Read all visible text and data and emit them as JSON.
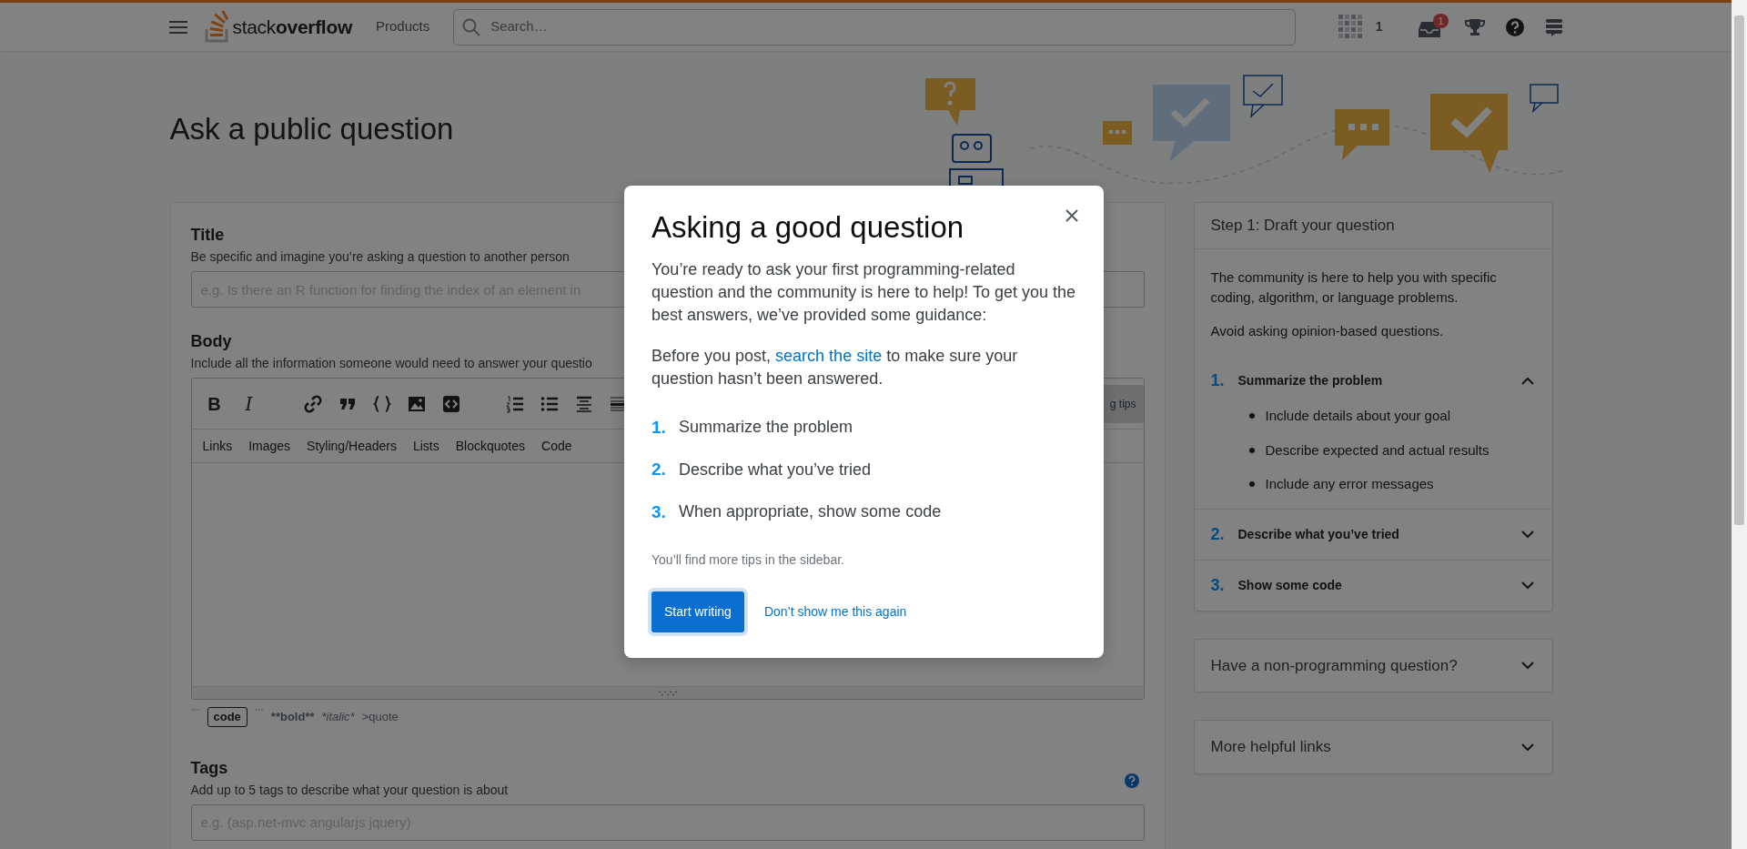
{
  "navbar": {
    "logo": "stack**overflow**",
    "products": "Products",
    "search": {
      "placeholder": "Search…"
    },
    "reputation": "1",
    "inbox_badge": "1"
  },
  "page": {
    "title": "Ask a public question"
  },
  "form": {
    "title_field": {
      "label": "Title",
      "hint": "Be specific and imagine you’re asking a question to another person",
      "placeholder": "e.g. Is there an R function for finding the index of an element in"
    },
    "body_field": {
      "label": "Body",
      "hint": "Include all the information someone would need to answer your questio",
      "toolbar": [
        {
          "kind": "bold",
          "label": "B"
        },
        {
          "kind": "italic",
          "label": "I"
        },
        {
          "kind": "link"
        },
        {
          "kind": "quote"
        },
        {
          "kind": "code"
        },
        {
          "kind": "image"
        },
        {
          "kind": "snippet"
        },
        {
          "kind": "ordered-list"
        },
        {
          "kind": "bulleted-list"
        },
        {
          "kind": "heading"
        },
        {
          "kind": "rule"
        }
      ],
      "tips_button": "g tips",
      "help_tabs": [
        "Links",
        "Images",
        "Styling/Headers",
        "Lists",
        "Blockquotes",
        "Code"
      ],
      "markdown_hints": [
        {
          "kind": "fence",
          "text": "```"
        },
        {
          "kind": "code",
          "text": "code"
        },
        {
          "kind": "fence",
          "text": "```"
        },
        {
          "kind": "bold",
          "text": "**bold**"
        },
        {
          "kind": "italic",
          "text": "*italic*"
        },
        {
          "kind": "plain",
          "text": ">quote"
        }
      ]
    },
    "tags_field": {
      "label": "Tags",
      "hint": "Add up to 5 tags to describe what your question is about",
      "placeholder": "e.g. (asp.net-mvc angularjs jquery)"
    }
  },
  "sidebar": {
    "card": {
      "title": "Step 1: Draft your question",
      "paragraphs": [
        "The community is here to help you with specific coding, algorithm, or language problems.",
        "Avoid asking opinion-based questions."
      ],
      "steps": [
        {
          "number": "1.",
          "title": "Summarize the problem",
          "expanded": true,
          "bullets": [
            "Include details about your goal",
            "Describe expected and actual results",
            "Include any error messages"
          ]
        },
        {
          "number": "2.",
          "title": "Describe what you’ve tried",
          "expanded": false
        },
        {
          "number": "3.",
          "title": "Show some code",
          "expanded": false
        }
      ]
    },
    "panels": [
      {
        "title": "Have a non-programming question?",
        "expanded": false
      },
      {
        "title": "More helpful links",
        "expanded": false
      }
    ]
  },
  "modal": {
    "title": "Asking a good question",
    "intro": "You’re ready to ask your first programming-related question and the community is here to help! To get you the best answers, we’ve provided some guidance:",
    "search_sentence": {
      "before": "Before you post, ",
      "link": "search the site",
      "after": " to make sure your question hasn’t been answered."
    },
    "steps": [
      {
        "number": "1.",
        "text": "Summarize the problem"
      },
      {
        "number": "2.",
        "text": "Describe what you’ve tried"
      },
      {
        "number": "3.",
        "text": "When appropriate, show some code"
      }
    ],
    "note": "You’ll find more tips in the sidebar.",
    "primary_button": "Start writing",
    "secondary_link": "Don’t show me this again"
  }
}
